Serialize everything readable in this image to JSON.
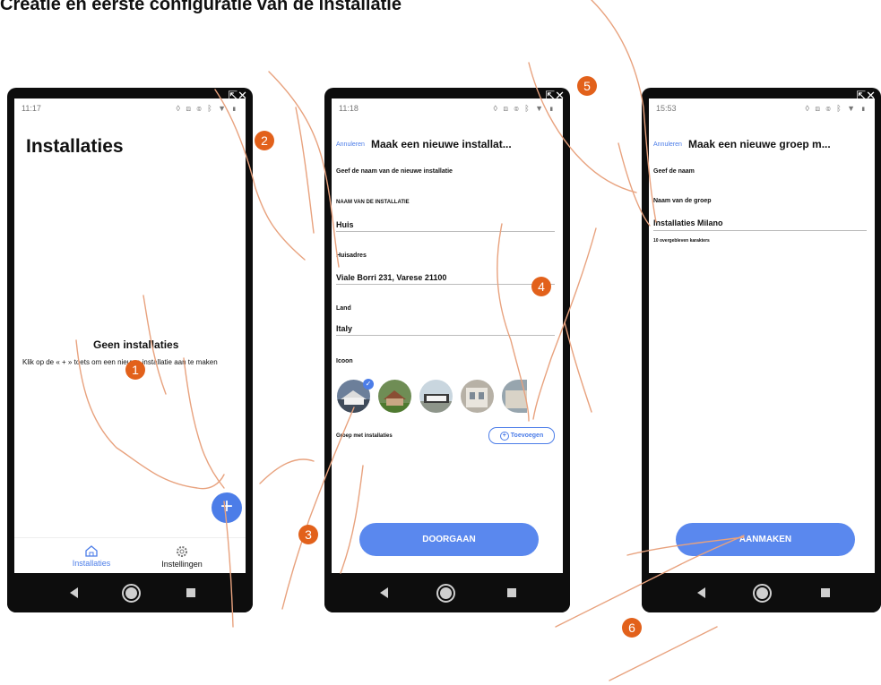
{
  "page_title": "Creatie en eerste configuratie van de installatie",
  "steps": [
    "1",
    "2",
    "3",
    "4",
    "5",
    "6"
  ],
  "phone_chrome": {
    "external_icon": "⇱✕",
    "status_icons": "◊ ▧ ◎ ᛒ ▼ ▮"
  },
  "screen1": {
    "time": "11:17",
    "title": "Installaties",
    "empty_title": "Geen installaties",
    "empty_hint": "Klik op de « + » toets om een nieuwe installatie aan te maken",
    "fab_label": "+",
    "tabs": [
      {
        "label": "Installaties",
        "icon": "home-icon",
        "active": true
      },
      {
        "label": "Instellingen",
        "icon": "gear-icon",
        "active": false
      }
    ]
  },
  "screen2": {
    "time": "11:18",
    "cancel": "Annuleren",
    "title": "Maak een nieuwe installat...",
    "subtitle": "Geef de naam van de nieuwe installatie",
    "name_label": "NAAM VAN DE INSTALLATIE",
    "name_value": "Huis",
    "address_label": "Huisadres",
    "address_value": "Viale Borri 231, Varese 21100",
    "country_label": "Land",
    "country_value": "Italy",
    "icon_label": "Icoon",
    "group_label": "Groep met installaties",
    "add_label": "Toevoegen",
    "continue_label": "DOORGAAN"
  },
  "screen3": {
    "time": "15:53",
    "cancel": "Annuleren",
    "title": "Maak een nieuwe groep m...",
    "subtitle": "Geef de naam",
    "field_label": "Naam van de groep",
    "field_value": "Installaties Milano",
    "char_hint": "10 overgebleven karakters",
    "create_label": "AANMAKEN"
  },
  "colors": {
    "accent": "#4c7de8",
    "button": "#5a88ee",
    "step": "#e2611b",
    "phone": "#0d0d0d"
  }
}
